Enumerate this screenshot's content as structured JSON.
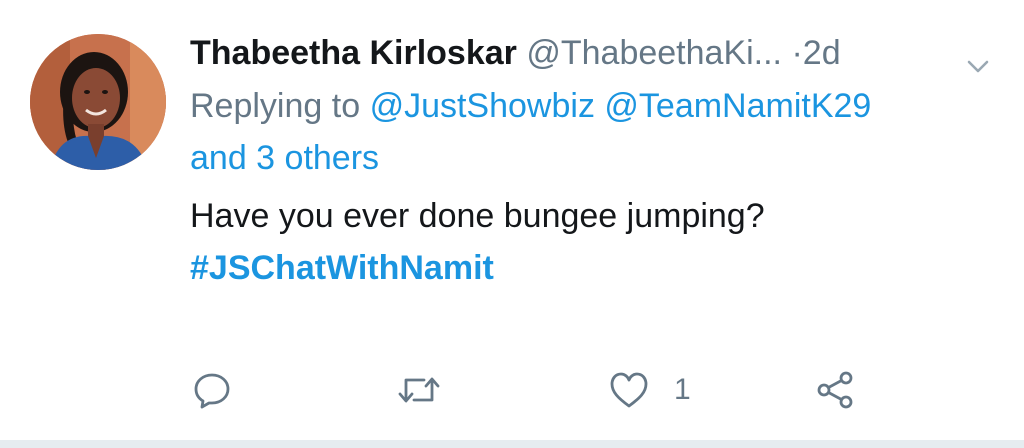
{
  "tweet": {
    "author_name": "Thabeetha Kirloskar",
    "author_handle": "@ThabeethaKi...",
    "separator": "·",
    "time": "2d",
    "replying_prefix": "Replying to",
    "mention_1": "@JustShowbiz",
    "mention_2": "@TeamNamitK29",
    "others": "and 3 others",
    "text": "Have you ever done bungee jumping?",
    "hashtag": "#JSChatWithNamit"
  },
  "actions": {
    "like_count": "1"
  },
  "icons": {
    "caret": "chevron-down-icon",
    "reply": "reply-icon",
    "retweet": "retweet-icon",
    "like": "heart-icon",
    "share": "share-icon"
  },
  "colors": {
    "link": "#1b95e0",
    "secondary": "#657786",
    "primary_text": "#14171a"
  }
}
